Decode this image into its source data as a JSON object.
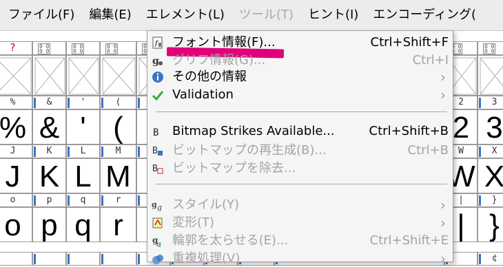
{
  "menubar": {
    "items": [
      {
        "label": "ファイル(F)",
        "disabled": false
      },
      {
        "label": "編集(E)",
        "disabled": false
      },
      {
        "label": "エレメント(L)",
        "disabled": false
      },
      {
        "label": "ツール(T)",
        "disabled": true
      },
      {
        "label": "ヒント(I)",
        "disabled": false
      },
      {
        "label": "エンコーディング(",
        "disabled": false
      }
    ]
  },
  "grid": {
    "row1_headers": [
      "?",
      "",
      "",
      "",
      "",
      "",
      "",
      "",
      "",
      "",
      ""
    ],
    "row2_headers": [
      "%",
      "&",
      "'",
      "(",
      "",
      "",
      "",
      "",
      "",
      "2",
      "3"
    ],
    "row2_glyphs": [
      "%",
      "&",
      "'",
      "(",
      "",
      "",
      "",
      "",
      "",
      "2",
      "3"
    ],
    "row3_headers": [
      "J",
      "K",
      "L",
      "M",
      "",
      "",
      "",
      "",
      "",
      "W",
      "X"
    ],
    "row3_glyphs": [
      "J",
      "K",
      "L",
      "M",
      "",
      "",
      "",
      "",
      "",
      "W",
      "X"
    ],
    "row4_headers": [
      "o",
      "p",
      "q",
      "r",
      "",
      "",
      "",
      "",
      "",
      "|",
      "}"
    ],
    "row4_glyphs": [
      "o",
      "p",
      "q",
      "r",
      "",
      "",
      "",
      "",
      "",
      "|",
      "}"
    ],
    "row5_headers": [
      "",
      "",
      "",
      "",
      "",
      "",
      "",
      "",
      "",
      "",
      "¢"
    ]
  },
  "menu": {
    "items": [
      {
        "label": "フォント情報(F)...",
        "shortcut": "Ctrl+Shift+F",
        "icon": "font-info-icon",
        "disabled": false
      },
      {
        "label": "グリフ情報(G)...",
        "shortcut": "Ctrl+I",
        "icon": "glyph-info-icon",
        "disabled": true
      },
      {
        "label": "その他の情報",
        "shortcut": "",
        "icon": "info-icon",
        "disabled": false
      },
      {
        "label": "Validation",
        "shortcut": "",
        "icon": "checkmark-icon",
        "disabled": false
      },
      {
        "label": "Bitmap Strikes Available...",
        "shortcut": "Ctrl+Shift+B",
        "icon": "bitmap-strikes-icon",
        "disabled": false
      },
      {
        "label": "ビットマップの再生成(B)...",
        "shortcut": "Ctrl+B",
        "icon": "regenerate-bitmap-icon",
        "disabled": true
      },
      {
        "label": "ビットマップを除去...",
        "shortcut": "",
        "icon": "remove-bitmap-icon",
        "disabled": true
      },
      {
        "label": "スタイル(Y)",
        "shortcut": "",
        "icon": "style-icon",
        "disabled": true
      },
      {
        "label": "変形(T)",
        "shortcut": "",
        "icon": "transform-icon",
        "disabled": true
      },
      {
        "label": "輪郭を太らせる(E)...",
        "shortcut": "Ctrl+Shift+E",
        "icon": "embolden-icon",
        "disabled": true
      },
      {
        "label": "重複処理(V)",
        "shortcut": "",
        "icon": "overlap-icon",
        "disabled": true
      }
    ],
    "highlight_color": "#e0007a"
  }
}
